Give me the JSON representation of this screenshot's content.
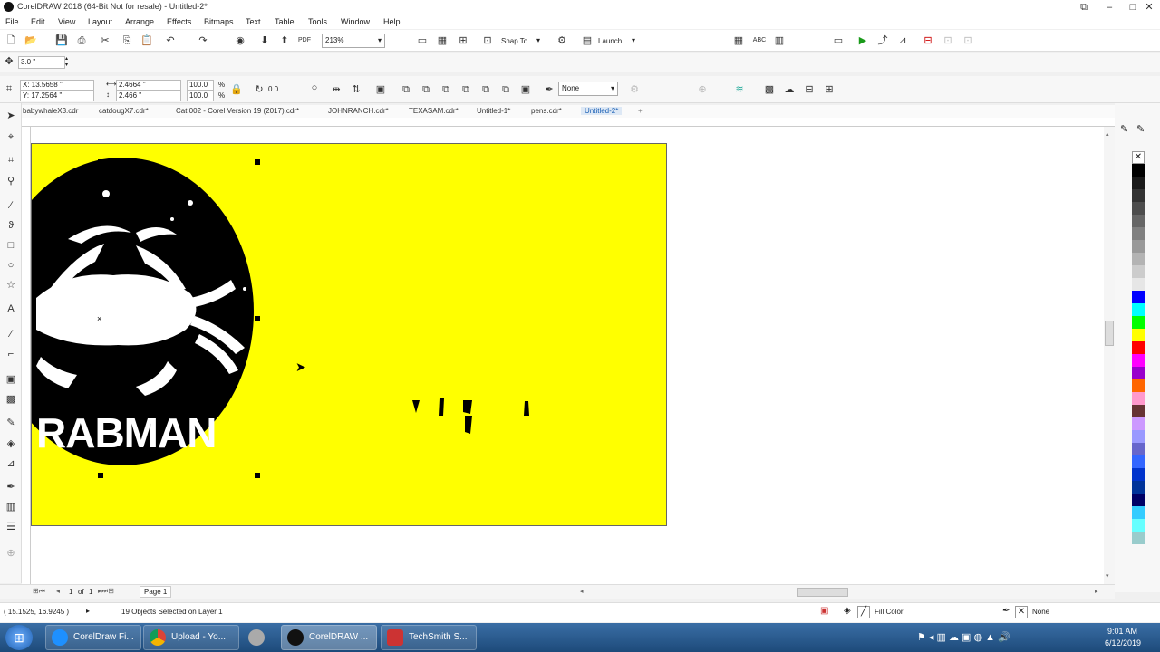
{
  "window": {
    "title": "CorelDRAW 2018 (64-Bit Not for resale) - Untitled-2*"
  },
  "menu": [
    "File",
    "Edit",
    "View",
    "Layout",
    "Arrange",
    "Effects",
    "Bitmaps",
    "Text",
    "Table",
    "Tools",
    "Window",
    "Help"
  ],
  "standard_toolbar": {
    "zoom": "213%",
    "snap_to": "Snap To",
    "launch": "Launch"
  },
  "property_bar": {
    "nudge": "3.0 \"",
    "x": "X: 13.5658 \"",
    "y": "Y: 17.2564 \"",
    "width": "2.4664 \"",
    "height": "2.466 \"",
    "scale_w": "100.0",
    "scale_h": "100.0",
    "pct1": "%",
    "pct2": "%",
    "rotation": "0.0",
    "outline": "None"
  },
  "doc_tabs": [
    "babywhaleX3.cdr",
    "catdougX7.cdr*",
    "Cat 002 - Corel Version 19 (2017).cdr*",
    "JOHNRANCH.cdr*",
    "TEXASAM.cdr*",
    "Untitled-1*",
    "pens.cdr*",
    "Untitled-2*"
  ],
  "active_tab": "Untitled-2*",
  "artwork": {
    "text": "RABMAN"
  },
  "page_nav": {
    "current": "1",
    "of": "of",
    "total": "1",
    "page_tab": "Page 1"
  },
  "status": {
    "coords": "( 15.1525, 16.9245 )",
    "selection": "19 Objects Selected on Layer 1",
    "fill": "Fill Color",
    "outline": "None"
  },
  "taskbar": {
    "items": [
      "CorelDraw Fi...",
      "Upload - Yo...",
      "",
      "CorelDRAW ...",
      "TechSmith S..."
    ],
    "time": "9:01 AM",
    "date": "6/12/2019"
  },
  "colors": {
    "page": "#ffff00",
    "palette": [
      "#ffffff",
      "#000000",
      "#1a1a1a",
      "#333333",
      "#4d4d4d",
      "#666666",
      "#808080",
      "#999999",
      "#b3b3b3",
      "#cccccc",
      "#e6e6e6",
      "#0000ff",
      "#00ffff",
      "#00ff00",
      "#ffff00",
      "#ff0000",
      "#ff00ff",
      "#9900cc",
      "#ff6600",
      "#ff99cc",
      "#663333",
      "#cc99ff",
      "#9999ff",
      "#6666cc",
      "#3366ff",
      "#0033cc",
      "#003399",
      "#000066",
      "#33ccff",
      "#66ffff",
      "#99cccc"
    ]
  }
}
